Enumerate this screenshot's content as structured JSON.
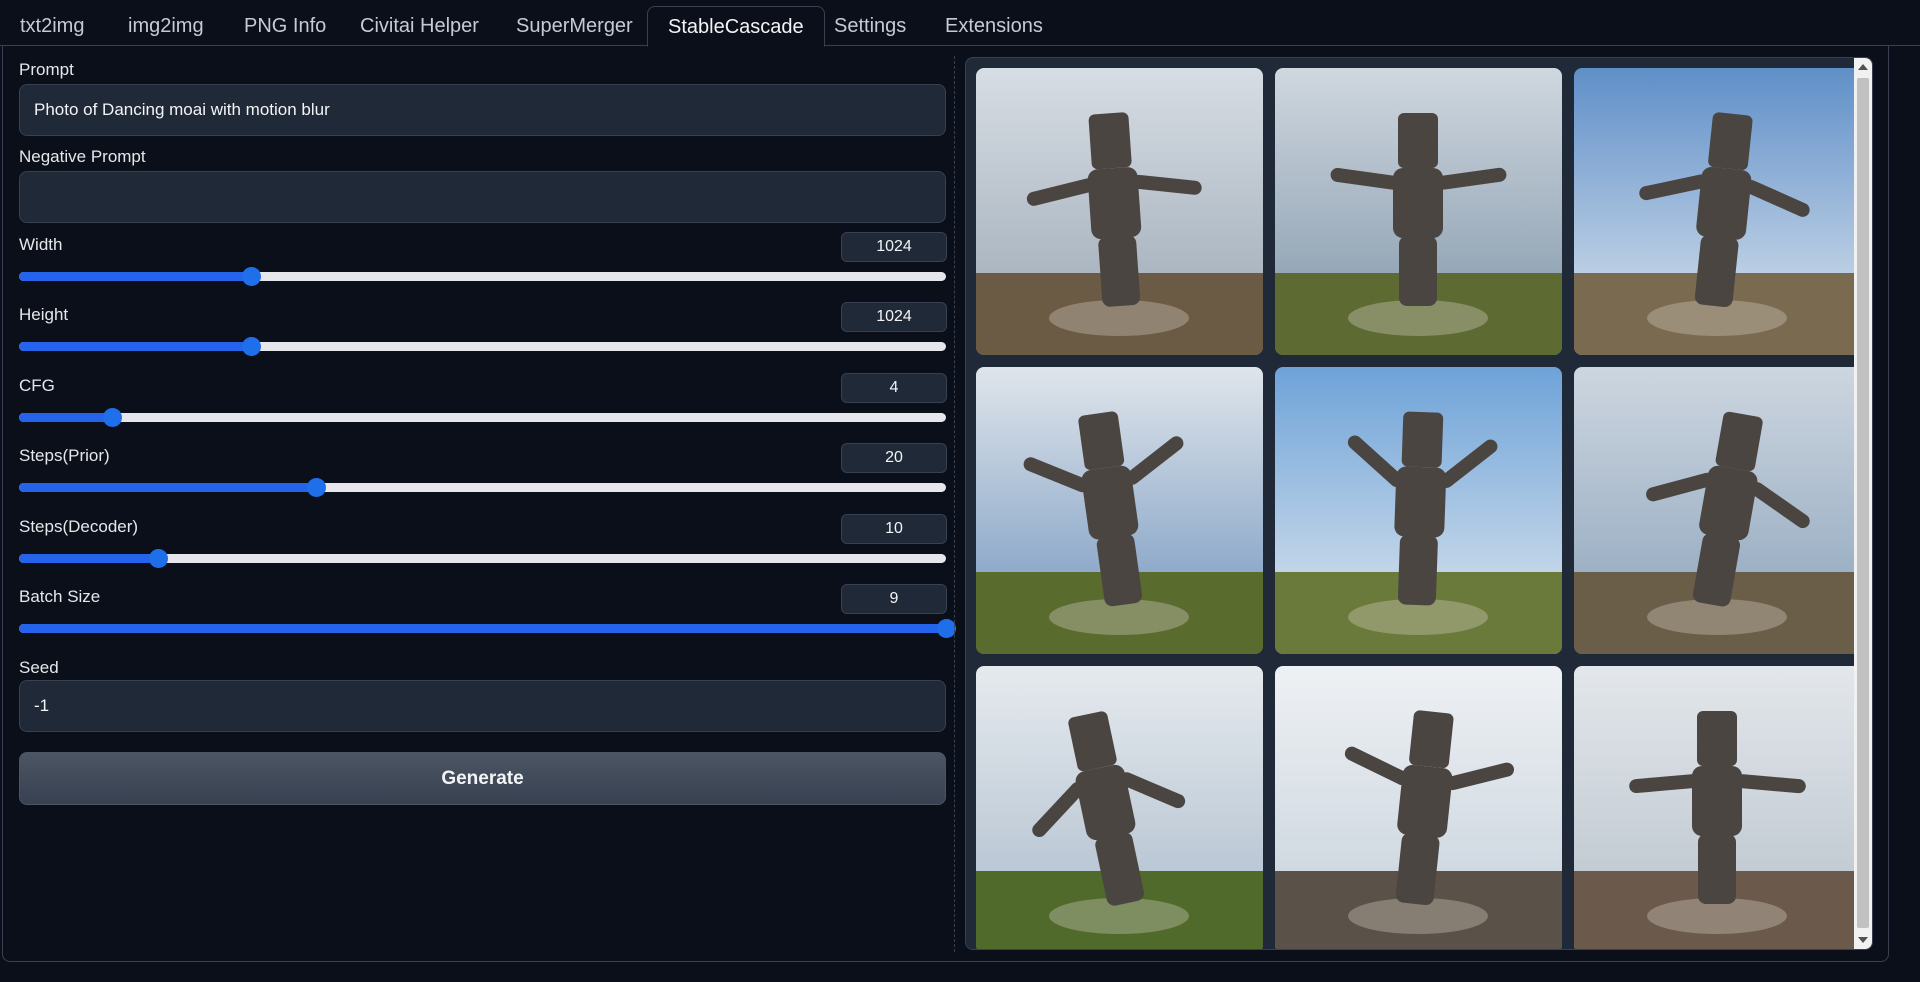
{
  "tabs": [
    {
      "label": "txt2img"
    },
    {
      "label": "img2img"
    },
    {
      "label": "PNG Info"
    },
    {
      "label": "Civitai Helper"
    },
    {
      "label": "SuperMerger"
    },
    {
      "label": "StableCascade",
      "active": true
    },
    {
      "label": "Settings"
    },
    {
      "label": "Extensions"
    }
  ],
  "form": {
    "prompt": {
      "label": "Prompt",
      "value": "Photo of Dancing moai with motion blur"
    },
    "negative_prompt": {
      "label": "Negative Prompt",
      "value": ""
    },
    "width": {
      "label": "Width",
      "value": "1024",
      "fraction": 0.25
    },
    "height": {
      "label": "Height",
      "value": "1024",
      "fraction": 0.25
    },
    "cfg": {
      "label": "CFG",
      "value": "4",
      "fraction": 0.1
    },
    "steps_prior": {
      "label": "Steps(Prior)",
      "value": "20",
      "fraction": 0.32
    },
    "steps_decoder": {
      "label": "Steps(Decoder)",
      "value": "10",
      "fraction": 0.15
    },
    "batch_size": {
      "label": "Batch Size",
      "value": "9",
      "fraction": 1.0
    },
    "seed": {
      "label": "Seed",
      "value": "-1"
    },
    "generate_label": "Generate"
  },
  "gallery": {
    "image_count": 9,
    "subject": "dancing moai statue with motion blur"
  },
  "colors": {
    "background": "#0b0f19",
    "panel": "#1f2937",
    "accent": "#2563eb",
    "border": "#374151"
  }
}
